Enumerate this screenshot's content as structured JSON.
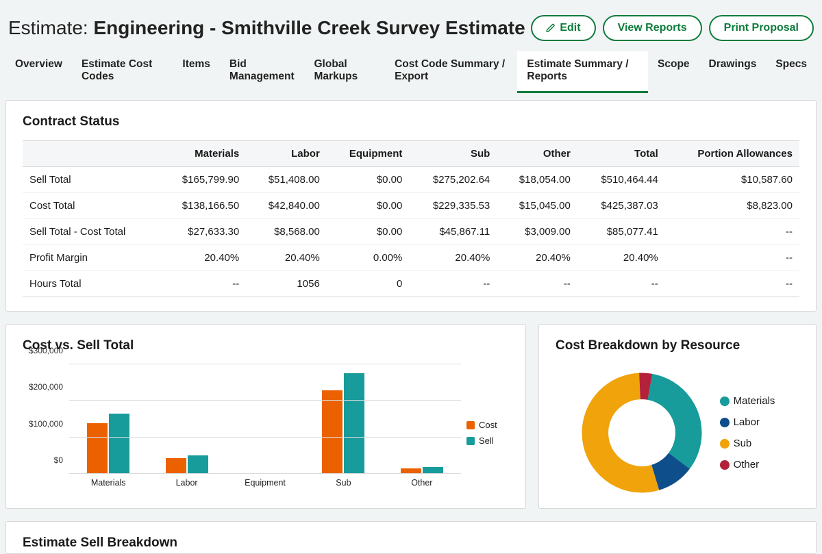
{
  "header": {
    "title_prefix": "Estimate: ",
    "title_bold": "Engineering - Smithville Creek Survey Estimate",
    "edit_label": "Edit",
    "view_reports_label": "View Reports",
    "print_proposal_label": "Print Proposal"
  },
  "tabs": [
    "Overview",
    "Estimate Cost Codes",
    "Items",
    "Bid Management",
    "Global Markups",
    "Cost Code Summary / Export",
    "Estimate Summary / Reports",
    "Scope",
    "Drawings",
    "Specs"
  ],
  "active_tab_index": 6,
  "contract_status": {
    "title": "Contract Status",
    "columns": [
      "",
      "Materials",
      "Labor",
      "Equipment",
      "Sub",
      "Other",
      "Total",
      "Portion Allowances"
    ],
    "rows": [
      {
        "label": "Sell Total",
        "cells": [
          "$165,799.90",
          "$51,408.00",
          "$0.00",
          "$275,202.64",
          "$18,054.00",
          "$510,464.44",
          "$10,587.60"
        ]
      },
      {
        "label": "Cost Total",
        "cells": [
          "$138,166.50",
          "$42,840.00",
          "$0.00",
          "$229,335.53",
          "$15,045.00",
          "$425,387.03",
          "$8,823.00"
        ]
      },
      {
        "label": "Sell Total - Cost Total",
        "cells": [
          "$27,633.30",
          "$8,568.00",
          "$0.00",
          "$45,867.11",
          "$3,009.00",
          "$85,077.41",
          "--"
        ]
      },
      {
        "label": "Profit Margin",
        "cells": [
          "20.40%",
          "20.40%",
          "0.00%",
          "20.40%",
          "20.40%",
          "20.40%",
          "--"
        ]
      },
      {
        "label": "Hours Total",
        "cells": [
          "--",
          "1056",
          "0",
          "--",
          "--",
          "--",
          "--"
        ]
      }
    ]
  },
  "cost_vs_sell": {
    "title": "Cost vs. Sell Total",
    "legend": {
      "cost": "Cost",
      "sell": "Sell"
    }
  },
  "cost_breakdown": {
    "title": "Cost Breakdown by Resource",
    "legend": [
      "Materials",
      "Labor",
      "Sub",
      "Other"
    ]
  },
  "estimate_sell_breakdown": {
    "title": "Estimate Sell Breakdown"
  },
  "colors": {
    "cost": "#eb6100",
    "sell": "#179b9b",
    "materials": "#179b9b",
    "labor": "#0e4f8b",
    "sub": "#f0a30a",
    "other": "#b3223a"
  },
  "chart_data": [
    {
      "type": "bar",
      "title": "Cost vs. Sell Total",
      "categories": [
        "Materials",
        "Labor",
        "Equipment",
        "Sub",
        "Other"
      ],
      "series": [
        {
          "name": "Cost",
          "values": [
            138166.5,
            42840.0,
            0.0,
            229335.53,
            15045.0
          ]
        },
        {
          "name": "Sell",
          "values": [
            165799.9,
            51408.0,
            0.0,
            275202.64,
            18054.0
          ]
        }
      ],
      "xlabel": "",
      "ylabel": "",
      "ylim": [
        0,
        300000
      ],
      "y_ticks": [
        "$0",
        "$100,000",
        "$200,000",
        "$300,000"
      ]
    },
    {
      "type": "pie",
      "title": "Cost Breakdown by Resource",
      "categories": [
        "Materials",
        "Labor",
        "Sub",
        "Other"
      ],
      "values": [
        138166.5,
        42840.0,
        229335.53,
        15045.0
      ]
    }
  ]
}
